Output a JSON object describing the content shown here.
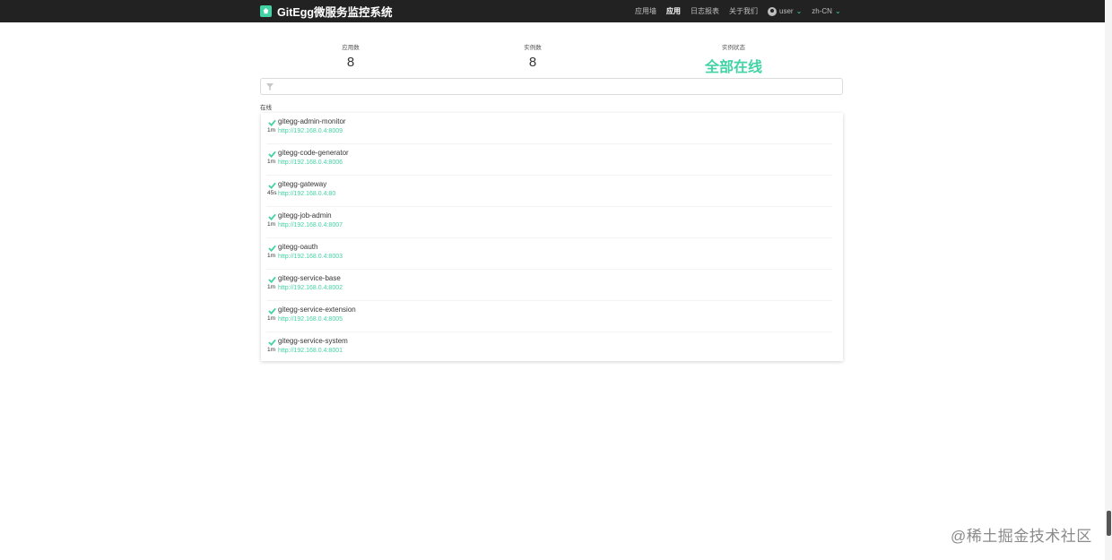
{
  "navbar": {
    "title": "GitEgg微服务监控系统",
    "menu": [
      "应用墙",
      "应用",
      "日志报表",
      "关于我们"
    ],
    "active": "应用",
    "user": "user",
    "locale": "zh-CN"
  },
  "stats": {
    "apps_label": "应用数",
    "apps_value": "8",
    "instances_label": "实例数",
    "instances_value": "8",
    "status_label": "实例状态",
    "status_value": "全部在线"
  },
  "filter": {
    "placeholder": ""
  },
  "group_label": "在线",
  "apps": [
    {
      "name": "gitegg-admin-monitor",
      "url": "http://192.168.0.4:8009",
      "uptime": "1m"
    },
    {
      "name": "gitegg-code-generator",
      "url": "http://192.168.0.4:8006",
      "uptime": "1m"
    },
    {
      "name": "gitegg-gateway",
      "url": "http://192.168.0.4:80",
      "uptime": "45s"
    },
    {
      "name": "gitegg-job-admin",
      "url": "http://192.168.0.4:8007",
      "uptime": "1m"
    },
    {
      "name": "gitegg-oauth",
      "url": "http://192.168.0.4:8003",
      "uptime": "1m"
    },
    {
      "name": "gitegg-service-base",
      "url": "http://192.168.0.4:8002",
      "uptime": "1m"
    },
    {
      "name": "gitegg-service-extension",
      "url": "http://192.168.0.4:8005",
      "uptime": "1m"
    },
    {
      "name": "gitegg-service-system",
      "url": "http://192.168.0.4:8001",
      "uptime": "1m"
    }
  ],
  "watermark": "@稀土掘金技术社区",
  "colors": {
    "accent": "#42d3a5",
    "navbar": "#222222"
  },
  "icons": [
    "brand-logo-icon",
    "user-avatar-icon",
    "chevron-down-icon",
    "filter-icon",
    "check-icon"
  ]
}
